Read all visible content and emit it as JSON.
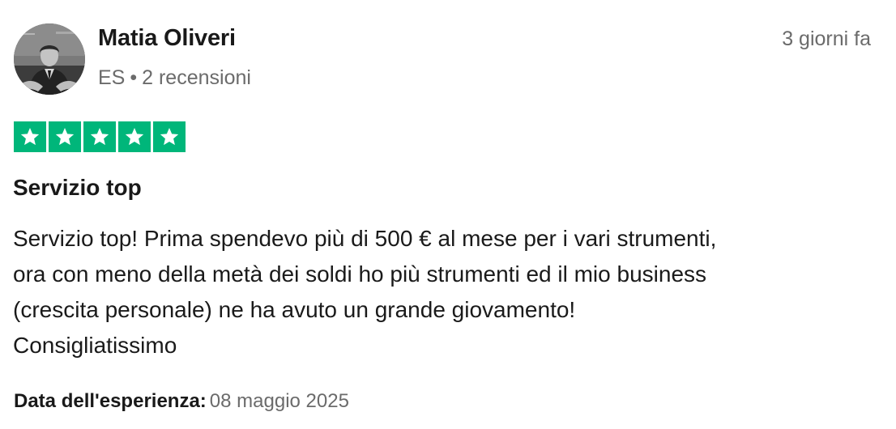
{
  "reviewer": {
    "name": "Matia Oliveri",
    "country": "ES",
    "separator": "•",
    "reviews_count": "2 recensioni"
  },
  "review": {
    "relative_date": "3 giorni fa",
    "rating": 5,
    "rating_max": 5,
    "star_color": "#00b67a",
    "title": "Servizio top",
    "body_lines": [
      "Servizio top! Prima spendevo più di 500 € al mese per i vari strumenti,",
      "ora con meno della metà dei soldi ho più strumenti ed il mio business",
      "(crescita personale) ne ha avuto un grande giovamento!",
      "Consigliatissimo"
    ],
    "experience_label": "Data dell'esperienza:",
    "experience_date": "08 maggio 2025"
  }
}
